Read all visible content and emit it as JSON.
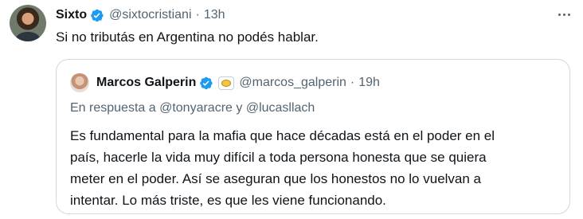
{
  "tweet": {
    "author": {
      "name": "Sixto",
      "handle": "@sixtocristiani",
      "time": "13h"
    },
    "separator": "·",
    "text": "Si no tributás en Argentina no podés hablar.",
    "quoted": {
      "author": {
        "name": "Marcos Galperin",
        "handle": "@marcos_galperin",
        "time": "19h"
      },
      "reply_prefix": "En respuesta a",
      "reply_to": [
        "@tonyaracre",
        "@lucasllach"
      ],
      "reply_conj": "y",
      "lines": [
        "Es fundamental para la mafia que hace décadas está en el poder en el",
        "país, hacerle la vida muy difícil a toda persona honesta que se quiera",
        "meter en el poder. Así se aseguran que los honestos no lo vuelvan a",
        "intentar. Lo más triste, es que les viene funcionando."
      ]
    }
  },
  "colors": {
    "verified": "#1d9bf0",
    "text_primary": "#0f1419",
    "text_secondary": "#536471",
    "border": "#cfd9de"
  },
  "icons": {
    "verified": "verified-badge-icon",
    "more": "more-options-icon",
    "affiliate": "affiliate-badge-icon"
  }
}
